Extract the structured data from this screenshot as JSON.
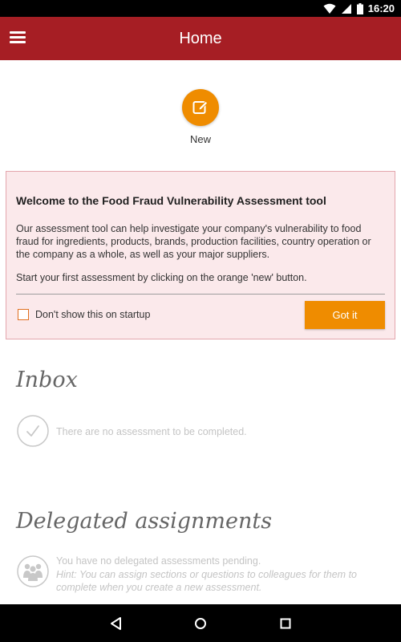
{
  "status_bar": {
    "time": "16:20",
    "icons": [
      "wifi-icon",
      "signal-icon",
      "battery-icon"
    ]
  },
  "app_bar": {
    "title": "Home",
    "menu_icon": "hamburger-menu-icon",
    "color": "#a61e24"
  },
  "new_button": {
    "label": "New",
    "icon": "edit-pencil-icon",
    "color": "#ef8c00"
  },
  "welcome_card": {
    "heading": "Welcome to the Food Fraud Vulnerability Assessment tool",
    "body1": "Our assessment tool can help investigate your company's vulnerability to food fraud for ingredients, products, brands, production facilities, country operation or the company as a whole, as well as your major suppliers.",
    "body2": "Start your first assessment by clicking on the orange 'new' button.",
    "checkbox_label": "Don't show this on startup",
    "checkbox_checked": false,
    "button_label": "Got it",
    "background_color": "#fbe9eb"
  },
  "inbox": {
    "title": "Inbox",
    "empty_icon": "checkmark-circle-icon",
    "empty_message": "There are no assessment to be completed."
  },
  "delegated": {
    "title": "Delegated assignments",
    "empty_icon": "group-people-icon",
    "empty_message": "You have no delegated assessments pending.",
    "hint": "Hint: You can assign sections or questions to colleagues for them to complete when you create a new assessment."
  },
  "nav_bar": {
    "icons": [
      "back-icon",
      "home-icon",
      "recents-icon"
    ]
  }
}
